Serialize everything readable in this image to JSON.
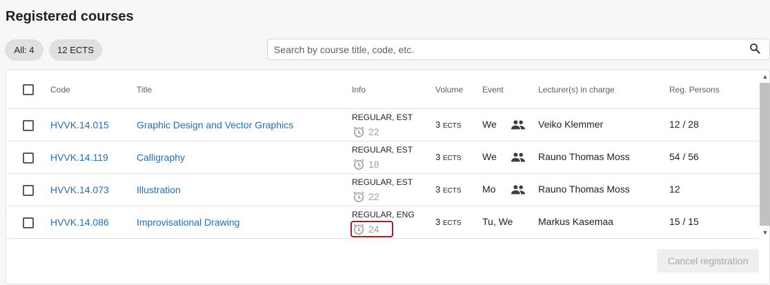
{
  "page_title": "Registered courses",
  "filters": {
    "all_label": "All: 4",
    "ects_label": "12 ECTS"
  },
  "search": {
    "placeholder": "Search by course title, code, etc.",
    "icon": "search-icon"
  },
  "table": {
    "headers": {
      "code": "Code",
      "title": "Title",
      "info": "Info",
      "volume": "Volume",
      "event": "Event",
      "lecturer": "Lecturer(s) in charge",
      "reg_persons": "Reg. Persons"
    },
    "rows": [
      {
        "code": "HVVK.14.015",
        "title": "Graphic Design and Vector Graphics",
        "info_type": "REGULAR, EST",
        "info_hours": "22",
        "volume": "3",
        "volume_unit": "ECTS",
        "event": "We",
        "group_icon": true,
        "lecturer": "Veiko Klemmer",
        "reg_persons": "12 / 28",
        "checked": false
      },
      {
        "code": "HVVK.14.119",
        "title": "Calligraphy",
        "info_type": "REGULAR, EST",
        "info_hours": "18",
        "volume": "3",
        "volume_unit": "ECTS",
        "event": "We",
        "group_icon": true,
        "lecturer": "Rauno Thomas Moss",
        "reg_persons": "54 / 56",
        "checked": false
      },
      {
        "code": "HVVK.14.073",
        "title": "Illustration",
        "info_type": "REGULAR, EST",
        "info_hours": "22",
        "volume": "3",
        "volume_unit": "ECTS",
        "event": "Mo",
        "group_icon": true,
        "lecturer": "Rauno Thomas Moss",
        "reg_persons": "12",
        "checked": false
      },
      {
        "code": "HVVK.14.086",
        "title": "Improvisational Drawing",
        "info_type": "REGULAR, ENG",
        "info_hours": "24",
        "volume": "3",
        "volume_unit": "ECTS",
        "event": "Tu, We",
        "group_icon": false,
        "lecturer": "Markus Kasemaa",
        "reg_persons": "15 / 15",
        "checked": false
      }
    ]
  },
  "actions": {
    "cancel_label": "Cancel registration",
    "cancel_enabled": false
  },
  "colors": {
    "link": "#1e6fc0",
    "highlight": "#a21d2e",
    "chip_bg": "#e0e0e0",
    "muted": "#a0a0a0"
  }
}
